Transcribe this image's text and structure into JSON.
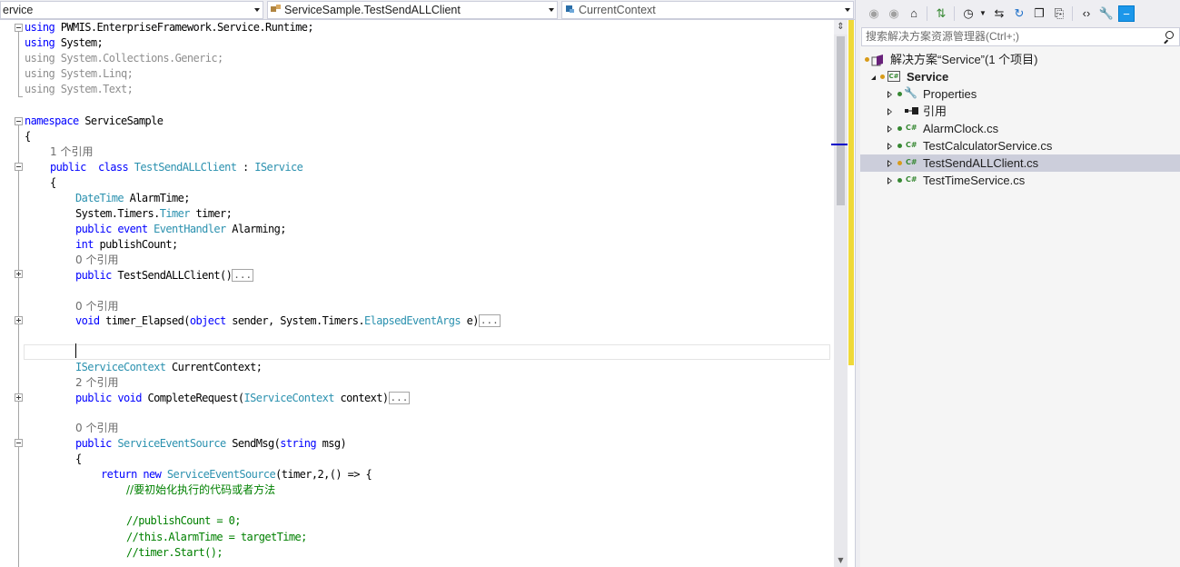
{
  "editor": {
    "nav": {
      "project": "ervice",
      "type": "ServiceSample.TestSendALLClient",
      "member": "CurrentContext"
    },
    "refs": {
      "one": "1 个引用",
      "zero": "0 个引用",
      "two": "2 个引用"
    },
    "code": {
      "l1_kw": "using",
      "l1_rest": " PWMIS.EnterpriseFramework.Service.Runtime;",
      "l2_kw": "using",
      "l2_rest": " System;",
      "l3": "using System.Collections.Generic;",
      "l4": "using System.Linq;",
      "l5": "using System.Text;",
      "ns_kw": "namespace",
      "ns_name": " ServiceSample",
      "brace_open": "{",
      "cls_kw1": "public",
      "cls_kw2": "  class ",
      "cls_name": "TestSendALLClient",
      "cls_colon": " : ",
      "cls_iface": "IService",
      "f1_type": "DateTime",
      "f1_rest": " AlarmTime;",
      "f2_a": "System.Timers.",
      "f2_type": "Timer",
      "f2_rest": " timer;",
      "f3_kw": "public event ",
      "f3_type": "EventHandler",
      "f3_rest": " Alarming;",
      "f4_kw": "int",
      "f4_rest": " publishCount;",
      "ctor_kw": "public",
      "ctor_rest": " TestSendALLClient()",
      "m1_kw": "void",
      "m1_a": " timer_Elapsed(",
      "m1_kw2": "object",
      "m1_b": " sender, System.Timers.",
      "m1_type": "ElapsedEventArgs",
      "m1_c": " e)",
      "ctx_type": "IServiceContext",
      "ctx_rest": " CurrentContext;",
      "m2_kw": "public void",
      "m2_a": " CompleteRequest(",
      "m2_type": "IServiceContext",
      "m2_b": " context)",
      "m3_kw": "public",
      "m3_type": " ServiceEventSource",
      "m3_a": " SendMsg(",
      "m3_kw2": "string",
      "m3_b": " msg)",
      "ret_kw": "return new",
      "ret_type": " ServiceEventSource",
      "ret_rest": "(timer,2,() => {",
      "cmt1": "//要初始化执行的代码或者方法",
      "cmt2": "//publishCount = 0;",
      "cmt3": "//this.AlarmTime = targetTime;",
      "cmt4": "//timer.Start();",
      "collapsed": "..."
    }
  },
  "solution_explorer": {
    "search_placeholder": "搜索解决方案资源管理器(Ctrl+;)",
    "solution_label": "解决方案“Service”(1 个项目)",
    "project_label": "Service",
    "items": [
      {
        "label": "Properties",
        "icon": "wrench-icon"
      },
      {
        "label": "引用",
        "icon": "references-icon"
      },
      {
        "label": "AlarmClock.cs",
        "icon": "csharp-file-icon"
      },
      {
        "label": "TestCalculatorService.cs",
        "icon": "csharp-file-icon"
      },
      {
        "label": "TestSendALLClient.cs",
        "icon": "csharp-file-icon"
      },
      {
        "label": "TestTimeService.cs",
        "icon": "csharp-file-icon"
      }
    ],
    "cs_badge": "C#",
    "colors": {
      "selected": "#cccedb",
      "accent": "#007acc",
      "green": "#368832",
      "pending": "#d89b18"
    }
  }
}
